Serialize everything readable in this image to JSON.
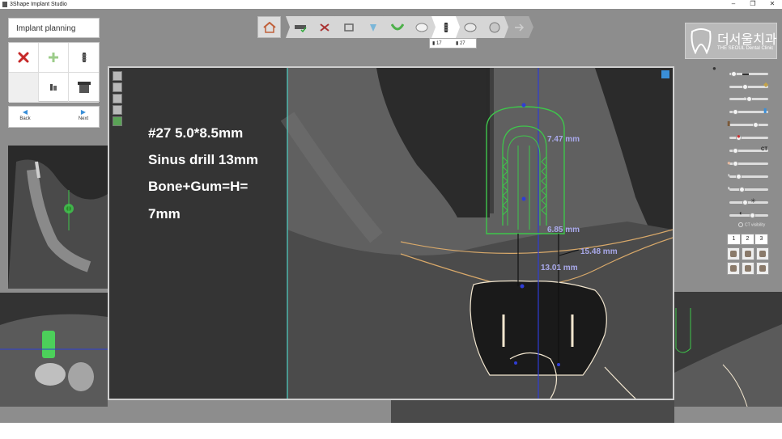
{
  "window": {
    "title": "3Shape Implant Studio",
    "controls": [
      "–",
      "❐",
      "✕"
    ]
  },
  "left_panel": {
    "header": "Implant planning",
    "tools": [
      {
        "icon": "delete-icon"
      },
      {
        "icon": "add-icon"
      },
      {
        "icon": "implant-icon"
      },
      {
        "icon": "blank"
      },
      {
        "icon": "abutment-icon"
      },
      {
        "icon": "sleeve-icon"
      }
    ],
    "nav": {
      "back": "Back",
      "next": "Next"
    }
  },
  "toolbar": {
    "steps": [
      "home-icon",
      "scan-import-icon",
      "segmentation-icon",
      "alignment-icon",
      "nerve-icon",
      "gum-icon",
      "tooth-icon",
      "implant-icon",
      "sleeve-icon",
      "guide-icon",
      "export-icon"
    ],
    "active_step": "implant-icon",
    "tooth_tabs": [
      "17",
      "27"
    ]
  },
  "viewport": {
    "notes": [
      "#27 5.0*8.5mm",
      "Sinus drill 13mm",
      "Bone+Gum=H=",
      "7mm"
    ],
    "measurements": {
      "width_top": "7.47 mm",
      "width_bottom": "6.85 mm",
      "length_long": "15.48 mm",
      "length_short": "13.01 mm"
    }
  },
  "logo": {
    "korean": "더서울치과",
    "english": "THE SEOUL Dental Clinic"
  },
  "right_panel": {
    "ct_label": "CT",
    "ct_visibility": "CT visibility",
    "view_tabs": [
      "1",
      "2",
      "3"
    ],
    "slider_levels": [
      0.05,
      0.4,
      0.5,
      0.1,
      0.7,
      0.2,
      0.1,
      0.1,
      0.2,
      0.3,
      0.4,
      0.6,
      0.3
    ]
  },
  "colors": {
    "implant_outline": "#3ec64b",
    "crown_outline": "#f2e6cf",
    "bone_outline": "#d9a96a",
    "axis_line": "#2f3dd6",
    "cursor_line": "#4fd1c5",
    "measure_text": "#a9a9ea"
  }
}
